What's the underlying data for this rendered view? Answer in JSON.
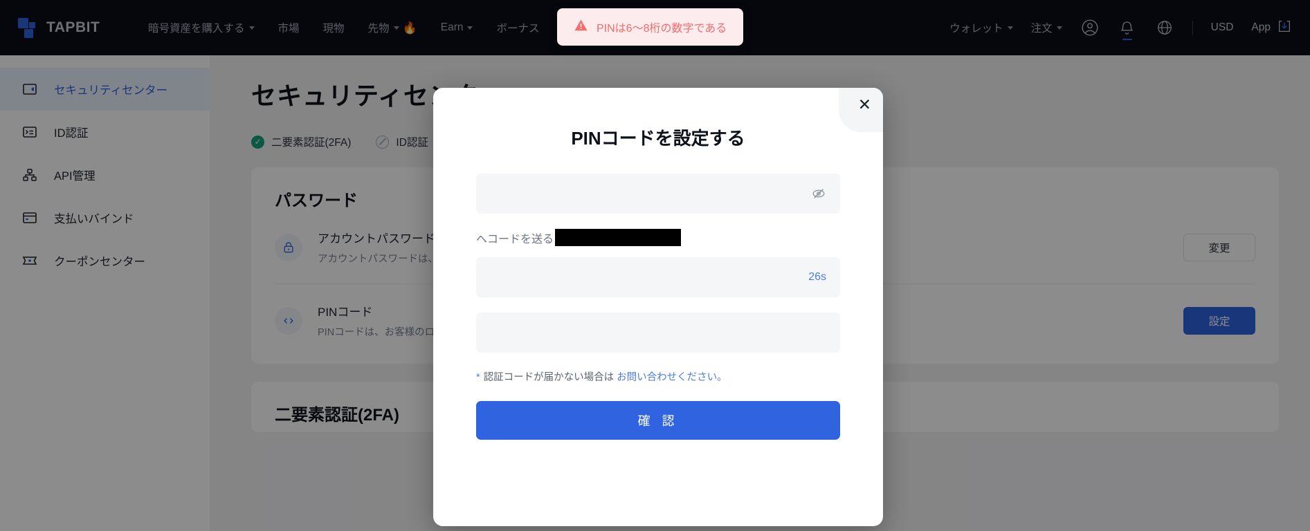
{
  "brand": {
    "name": "TAPBIT"
  },
  "nav": {
    "items": [
      {
        "label": "暗号資産を購入する",
        "caret": true,
        "flame": false
      },
      {
        "label": "市場",
        "caret": false,
        "flame": false
      },
      {
        "label": "現物",
        "caret": false,
        "flame": false
      },
      {
        "label": "先物",
        "caret": true,
        "flame": true
      },
      {
        "label": "Earn",
        "caret": true,
        "flame": false
      },
      {
        "label": "ボーナス",
        "caret": false,
        "flame": false
      }
    ],
    "right": {
      "wallet": "ウォレット",
      "orders": "注文",
      "currency": "USD",
      "app": "App",
      "icons": [
        "account-icon",
        "bell-icon",
        "globe-icon",
        "download-icon"
      ]
    }
  },
  "toast": {
    "icon": "warning-triangle-icon",
    "message": "PINは6〜8桁の数字である",
    "color": "#f56c6c",
    "background": "#fdeced"
  },
  "sidebar": {
    "items": [
      {
        "label": "セキュリティセンター",
        "icon": "shield-card-icon",
        "active": true
      },
      {
        "label": "ID認証",
        "icon": "id-card-icon",
        "active": false
      },
      {
        "label": "API管理",
        "icon": "api-nodes-icon",
        "active": false
      },
      {
        "label": "支払いバインド",
        "icon": "payment-card-icon",
        "active": false
      },
      {
        "label": "クーポンセンター",
        "icon": "ticket-icon",
        "active": false
      }
    ]
  },
  "main": {
    "title": "セキュリティセンター",
    "status": [
      {
        "label": "二要素認証(2FA)",
        "state": "on"
      },
      {
        "label": "ID認証",
        "state": "off"
      }
    ],
    "password_card": {
      "title": "パスワード",
      "rows": [
        {
          "name": "アカウントパスワード",
          "desc": "アカウントパスワードは、ログイン時に使用されます。",
          "icon": "lock-icon",
          "action": "変更",
          "action_style": "ghost"
        },
        {
          "name": "PINコード",
          "desc": "PINコードは、お客様のログインと取引に使用されます。",
          "icon": "code-icon",
          "action": "設定",
          "action_style": "primary"
        }
      ]
    },
    "twofa_card": {
      "title": "二要素認証(2FA)"
    }
  },
  "modal": {
    "title": "PINコードを設定する",
    "close_icon": "close-icon",
    "pin_field": {
      "value": "",
      "placeholder": "",
      "toggle_icon": "eye-off-icon"
    },
    "send_label": "へコードを送る",
    "send_target_redacted": true,
    "code_field": {
      "value": "",
      "placeholder": "",
      "timer": "26s"
    },
    "confirm_field": {
      "value": "",
      "placeholder": ""
    },
    "hint": {
      "star": "*",
      "text": "認証コードが届かない場合は ",
      "link": "お問い合わせください。"
    },
    "confirm_button": "確 認",
    "accent_color": "#2f63e0"
  }
}
